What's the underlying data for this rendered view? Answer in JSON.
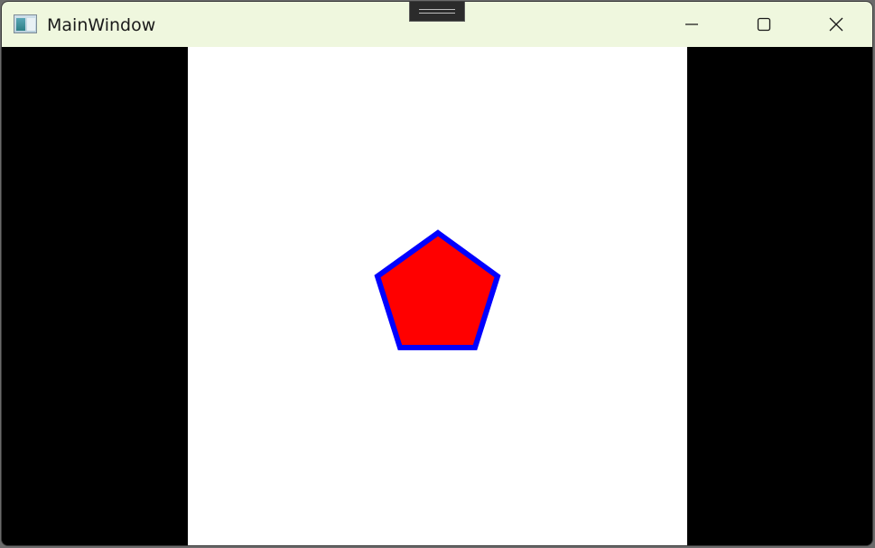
{
  "window": {
    "title": "MainWindow"
  },
  "icons": {
    "app": "app-window-icon",
    "minimize": "minimize-icon",
    "maximize": "maximize-icon",
    "close": "close-icon",
    "snap": "snap-layout-handle"
  },
  "colors": {
    "titlebar": "#eff7de",
    "client_background": "#000000",
    "canvas_background": "#ffffff",
    "shape_fill": "#ff0000",
    "shape_stroke": "#0000ff"
  },
  "shape": {
    "type": "pentagon",
    "fill": "#ff0000",
    "stroke": "#0000ff"
  }
}
